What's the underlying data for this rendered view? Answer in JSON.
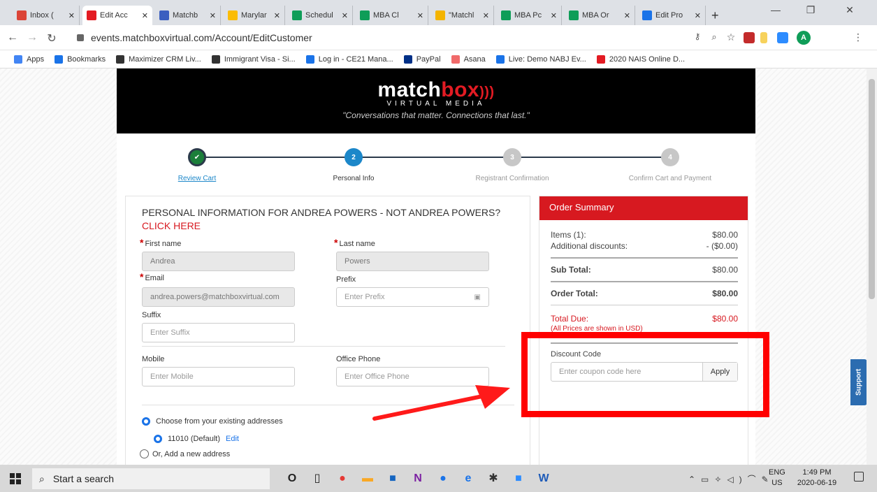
{
  "browser": {
    "tabs": [
      {
        "label": "Inbox (",
        "color": "#db4437",
        "icon": "gmail-icon"
      },
      {
        "label": "Edit Acc",
        "color": "#e31b23",
        "icon": "matchbox-icon",
        "active": true
      },
      {
        "label": "Matchb",
        "color": "#3b5fc0",
        "icon": "calendar-icon"
      },
      {
        "label": "Marylar",
        "color": "#fbbc04",
        "icon": "drive-icon"
      },
      {
        "label": "Schedul",
        "color": "#0f9d58",
        "icon": "sheets-icon"
      },
      {
        "label": "MBA Cl",
        "color": "#0f9d58",
        "icon": "sheets-icon"
      },
      {
        "label": "\"Matchl",
        "color": "#f4b400",
        "icon": "slides-icon"
      },
      {
        "label": "MBA Pc",
        "color": "#0f9d58",
        "icon": "sheets-icon"
      },
      {
        "label": "MBA Or",
        "color": "#0f9d58",
        "icon": "sheets-icon"
      },
      {
        "label": "Edit Pro",
        "color": "#1a73e8",
        "icon": "star-person-icon"
      }
    ],
    "tab_close": "✕",
    "new_tab": "+",
    "url": "events.matchboxvirtual.com/Account/EditCustomer",
    "profile_letter": "A",
    "bookmarks": [
      {
        "label": "Apps",
        "icon": "apps-grid-icon",
        "color": "#4285f4"
      },
      {
        "label": "Bookmarks",
        "icon": "star-icon",
        "color": "#1a73e8"
      },
      {
        "label": "Maximizer CRM Liv...",
        "icon": "maximizer-icon",
        "color": "#333"
      },
      {
        "label": "Immigrant Visa - Si...",
        "icon": "globe-icon",
        "color": "#333"
      },
      {
        "label": "Log in - CE21 Mana...",
        "icon": "ce21-icon",
        "color": "#1a73e8"
      },
      {
        "label": "PayPal",
        "icon": "paypal-icon",
        "color": "#003087"
      },
      {
        "label": "Asana",
        "icon": "asana-icon",
        "color": "#f06a6a"
      },
      {
        "label": "Live: Demo NABJ Ev...",
        "icon": "circle-icon",
        "color": "#1a73e8"
      },
      {
        "label": "2020 NAIS Online D...",
        "icon": "matchbox-icon",
        "color": "#e31b23"
      }
    ]
  },
  "site": {
    "logo_part1": "match",
    "logo_part2": "box",
    "logo_sub": "VIRTUAL MEDIA",
    "tagline": "\"Conversations that matter. Connections that last.\"",
    "steps": [
      {
        "num": "✔",
        "label": "Review Cart",
        "state": "done"
      },
      {
        "num": "2",
        "label": "Personal Info",
        "state": "current"
      },
      {
        "num": "3",
        "label": "Registrant Confirmation",
        "state": "todo"
      },
      {
        "num": "4",
        "label": "Confirm Cart and Payment",
        "state": "todo"
      }
    ]
  },
  "form": {
    "heading": "PERSONAL INFORMATION FOR ANDREA POWERS - NOT ANDREA POWERS?",
    "click_here": "CLICK HERE",
    "first_name_label": "First name",
    "first_name_value": "Andrea",
    "last_name_label": "Last name",
    "last_name_value": "Powers",
    "email_label": "Email",
    "email_value": "andrea.powers@matchboxvirtual.com",
    "prefix_label": "Prefix",
    "prefix_placeholder": "Enter Prefix",
    "suffix_label": "Suffix",
    "suffix_placeholder": "Enter Suffix",
    "mobile_label": "Mobile",
    "mobile_placeholder": "Enter Mobile",
    "office_label": "Office Phone",
    "office_placeholder": "Enter Office Phone",
    "choose_existing": "Choose from your existing addresses",
    "address_option": "11010 (Default)",
    "edit_link": "Edit",
    "add_new": "Or, Add a new address"
  },
  "summary": {
    "title": "Order Summary",
    "items_label": "Items (1):",
    "items_value": "$80.00",
    "discounts_label": "Additional discounts:",
    "discounts_value": "- ($0.00)",
    "subtotal_label": "Sub Total:",
    "subtotal_value": "$80.00",
    "order_total_label": "Order Total:",
    "order_total_value": "$80.00",
    "total_due_label": "Total Due:",
    "total_due_value": "$80.00",
    "currency_note": "(All Prices are shown in USD)",
    "discount_code_label": "Discount Code",
    "coupon_placeholder": "Enter coupon code here",
    "apply_label": "Apply"
  },
  "support_label": "Support",
  "taskbar": {
    "search_placeholder": "Start a search",
    "lang": "ENG",
    "region": "US",
    "time": "1:49 PM",
    "date": "2020-06-19"
  }
}
